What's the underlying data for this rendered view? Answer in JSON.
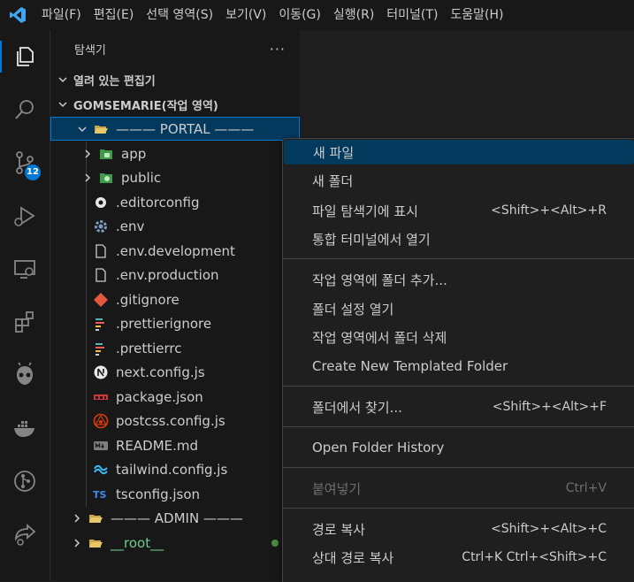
{
  "menubar": {
    "items": [
      "파일(F)",
      "편집(E)",
      "선택 영역(S)",
      "보기(V)",
      "이동(G)",
      "실행(R)",
      "터미널(T)",
      "도움말(H)"
    ]
  },
  "activity_bar": {
    "items": [
      {
        "name": "explorer-icon",
        "active": true
      },
      {
        "name": "search-icon"
      },
      {
        "name": "source-control-icon",
        "badge": "12"
      },
      {
        "name": "run-debug-icon"
      },
      {
        "name": "remote-explorer-icon"
      },
      {
        "name": "extensions-icon"
      },
      {
        "name": "platformio-icon"
      },
      {
        "name": "docker-icon"
      },
      {
        "name": "gitlens-icon"
      },
      {
        "name": "live-share-icon"
      }
    ]
  },
  "sidebar": {
    "title": "탐색기",
    "more": "···",
    "open_editors": "열려 있는 편집기",
    "workspace": "GOMSEMARIE(작업 영역)",
    "portal_folder": "——— PORTAL ———",
    "items": [
      {
        "label": "app",
        "icon": "folder-app-icon",
        "type": "folder"
      },
      {
        "label": "public",
        "icon": "folder-public-icon",
        "type": "folder"
      },
      {
        "label": ".editorconfig",
        "icon": "editorconfig-icon"
      },
      {
        "label": ".env",
        "icon": "gear-icon"
      },
      {
        "label": ".env.development",
        "icon": "file-icon"
      },
      {
        "label": ".env.production",
        "icon": "file-icon"
      },
      {
        "label": ".gitignore",
        "icon": "git-icon"
      },
      {
        "label": ".prettierignore",
        "icon": "prettier-icon"
      },
      {
        "label": ".prettierrc",
        "icon": "prettier-icon"
      },
      {
        "label": "next.config.js",
        "icon": "nextjs-icon"
      },
      {
        "label": "package.json",
        "icon": "npm-icon"
      },
      {
        "label": "postcss.config.js",
        "icon": "postcss-icon"
      },
      {
        "label": "README.md",
        "icon": "markdown-icon"
      },
      {
        "label": "tailwind.config.js",
        "icon": "tailwind-icon"
      },
      {
        "label": "tsconfig.json",
        "icon": "typescript-icon"
      }
    ],
    "admin_folder": "——— ADMIN ———",
    "root_folder": "__root__"
  },
  "context_menu": {
    "groups": [
      [
        {
          "label": "새 파일",
          "shortcut": ""
        },
        {
          "label": "새 폴더",
          "shortcut": ""
        },
        {
          "label": "파일 탐색기에 표시",
          "shortcut": "<Shift>+<Alt>+R"
        },
        {
          "label": "통합 터미널에서 열기",
          "shortcut": ""
        }
      ],
      [
        {
          "label": "작업 영역에 폴더 추가...",
          "shortcut": ""
        },
        {
          "label": "폴더 설정 열기",
          "shortcut": ""
        },
        {
          "label": "작업 영역에서 폴더 삭제",
          "shortcut": ""
        },
        {
          "label": "Create New Templated Folder",
          "shortcut": ""
        }
      ],
      [
        {
          "label": "폴더에서 찾기...",
          "shortcut": "<Shift>+<Alt>+F"
        }
      ],
      [
        {
          "label": "Open Folder History",
          "shortcut": ""
        }
      ],
      [
        {
          "label": "붙여넣기",
          "shortcut": "Ctrl+V",
          "disabled": true
        }
      ],
      [
        {
          "label": "경로 복사",
          "shortcut": "<Shift>+<Alt>+C"
        },
        {
          "label": "상대 경로 복사",
          "shortcut": "Ctrl+K Ctrl+<Shift>+C"
        }
      ]
    ],
    "highlighted": "새 파일"
  },
  "colors": {
    "accent": "#0078d4",
    "selection": "#04395e",
    "background": "#1f1f1f",
    "sidebar": "#181818",
    "root_folder_text": "#73c991"
  }
}
